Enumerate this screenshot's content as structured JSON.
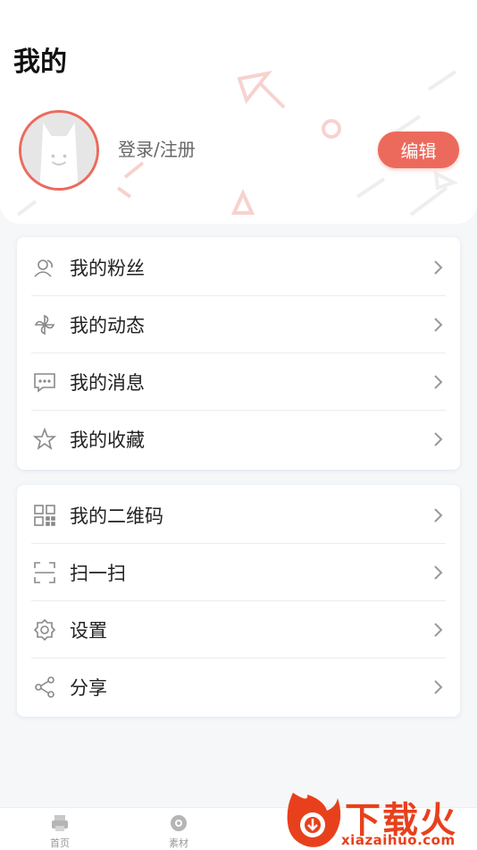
{
  "page": {
    "title": "我的"
  },
  "profile": {
    "login_text": "登录/注册",
    "edit_label": "编辑",
    "accent": "#ec6a5c"
  },
  "menu_group_1": [
    {
      "label": "我的粉丝",
      "icon": "fans-icon"
    },
    {
      "label": "我的动态",
      "icon": "pinwheel-icon"
    },
    {
      "label": "我的消息",
      "icon": "message-icon"
    },
    {
      "label": "我的收藏",
      "icon": "star-icon"
    }
  ],
  "menu_group_2": [
    {
      "label": "我的二维码",
      "icon": "qrcode-icon"
    },
    {
      "label": "扫一扫",
      "icon": "scan-icon"
    },
    {
      "label": "设置",
      "icon": "gear-icon"
    },
    {
      "label": "分享",
      "icon": "share-icon"
    }
  ],
  "tabbar": [
    {
      "label": "首页",
      "icon": "printer-icon"
    },
    {
      "label": "素材",
      "icon": "camera-icon"
    }
  ],
  "watermark": {
    "name": "下载火",
    "domain": "xiazaihuo.com",
    "color": "#e8401c"
  }
}
